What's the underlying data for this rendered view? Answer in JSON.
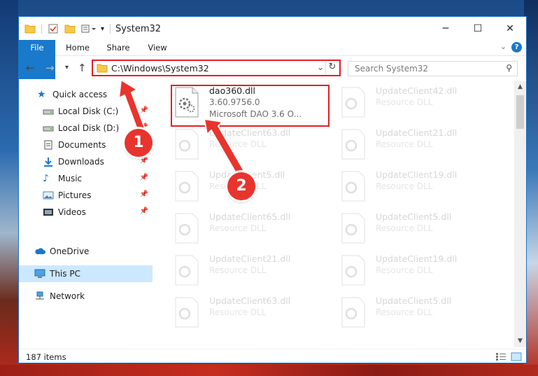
{
  "window": {
    "title": "System32",
    "controls": {
      "minimize": "─",
      "maximize": "☐",
      "close": "✕"
    }
  },
  "ribbon": {
    "tabs": [
      {
        "label": "File"
      },
      {
        "label": "Home"
      },
      {
        "label": "Share"
      },
      {
        "label": "View"
      }
    ],
    "help": "?"
  },
  "address": {
    "path": "C:\\Windows\\System32",
    "search_placeholder": "Search System32"
  },
  "nav": {
    "items": [
      {
        "label": "Quick access",
        "icon": "star-icon",
        "pinned": false
      },
      {
        "label": "Local Disk (C:)",
        "icon": "drive-icon",
        "pinned": true
      },
      {
        "label": "Local Disk (D:)",
        "icon": "drive-icon",
        "pinned": true
      },
      {
        "label": "Documents",
        "icon": "documents-icon",
        "pinned": true
      },
      {
        "label": "Downloads",
        "icon": "downloads-icon",
        "pinned": true
      },
      {
        "label": "Music",
        "icon": "music-icon",
        "pinned": true
      },
      {
        "label": "Pictures",
        "icon": "pictures-icon",
        "pinned": true
      },
      {
        "label": "Videos",
        "icon": "videos-icon",
        "pinned": true
      },
      {
        "label": "OneDrive",
        "icon": "cloud-icon",
        "pinned": false
      },
      {
        "label": "This PC",
        "icon": "computer-icon",
        "pinned": false,
        "selected": true
      },
      {
        "label": "Network",
        "icon": "network-icon",
        "pinned": false
      }
    ]
  },
  "files": {
    "highlighted": {
      "name": "dao360.dll",
      "version": "3.60.9756.0",
      "description": "Microsoft DAO 3.6 O..."
    },
    "left_column": [
      {
        "name": "UpdateClient63.dll",
        "type": "Resource DLL"
      },
      {
        "name": "UpdateClient5.dll",
        "type": "Resource DLL"
      },
      {
        "name": "UpdateClient65.dll",
        "type": "Resource DLL"
      },
      {
        "name": "UpdateClient21.dll",
        "type": "Resource DLL"
      },
      {
        "name": "UpdateClient63.dll",
        "type": "Resource DLL"
      }
    ],
    "right_column": [
      {
        "name": "UpdateClient42.dll",
        "type": "Resource DLL"
      },
      {
        "name": "UpdateClient21.dll",
        "type": "Resource DLL"
      },
      {
        "name": "UpdateClient19.dll",
        "type": "Resource DLL"
      },
      {
        "name": "UpdateClient5.dll",
        "type": "Resource DLL"
      },
      {
        "name": "UpdateClient19.dll",
        "type": "Resource DLL"
      },
      {
        "name": "UpdateClient5.dll",
        "type": "Resource DLL"
      }
    ]
  },
  "status": {
    "item_count": "187 items"
  },
  "annotations": {
    "marker1": "1",
    "marker2": "2"
  },
  "colors": {
    "accent": "#1979ca",
    "highlight_red": "#e11f26",
    "marker_red": "#e8342d"
  }
}
